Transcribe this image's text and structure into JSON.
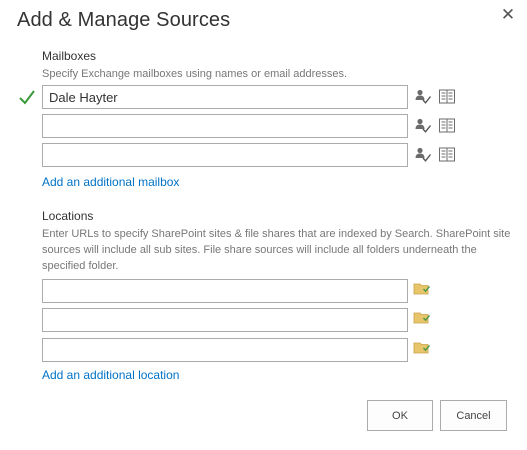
{
  "dialog": {
    "title": "Add & Manage Sources",
    "close_glyph": "✕"
  },
  "mailboxes": {
    "heading": "Mailboxes",
    "description": "Specify Exchange mailboxes using names or email addresses.",
    "rows": [
      {
        "value": "Dale Hayter",
        "placeholder": "",
        "validated": true
      },
      {
        "value": "",
        "placeholder": "",
        "validated": false
      },
      {
        "value": "",
        "placeholder": "",
        "validated": false
      }
    ],
    "add_link": "Add an additional mailbox",
    "icons": [
      "check-names-icon",
      "address-book-icon"
    ]
  },
  "locations": {
    "heading": "Locations",
    "description": "Enter URLs to specify SharePoint sites & file shares that are indexed by Search. SharePoint site sources will include all sub sites. File share sources will include all folders underneath the specified folder.",
    "rows": [
      {
        "value": "",
        "placeholder": ""
      },
      {
        "value": "",
        "placeholder": ""
      },
      {
        "value": "",
        "placeholder": ""
      }
    ],
    "add_link": "Add an additional location",
    "icons": [
      "browse-folder-icon"
    ]
  },
  "buttons": {
    "ok": "OK",
    "cancel": "Cancel"
  },
  "colors": {
    "link": "#0072c6",
    "check_green": "#3a9a3a",
    "folder_yellow": "#e8c46a",
    "border": "#ababab"
  }
}
